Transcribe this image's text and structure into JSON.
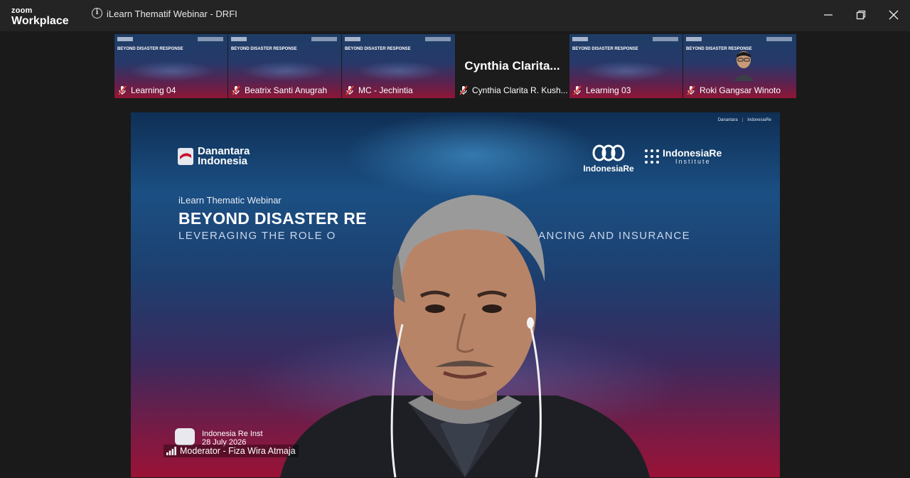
{
  "app": {
    "brand_small": "zoom",
    "brand_big": "Workplace",
    "window_title": "iLearn Thematif Webinar - DRFI"
  },
  "gallery": [
    {
      "name": "Learning 04",
      "muted": true,
      "has_video": true
    },
    {
      "name": "Beatrix Santi Anugrah",
      "muted": true,
      "has_video": true
    },
    {
      "name": "MC - Jechintia",
      "muted": true,
      "has_video": true
    },
    {
      "name": "Cynthia Clarita R. Kush...",
      "display_name": "Cynthia  Clarita...",
      "muted": true,
      "has_video": false
    },
    {
      "name": "Learning 03",
      "muted": true,
      "has_video": true
    },
    {
      "name": "Roki Gangsar Winoto",
      "muted": true,
      "has_video": true
    }
  ],
  "slide": {
    "mini_title": "BEYOND DISASTER RESPONSE",
    "org_left_line1": "Danantara",
    "org_left_line2": "Indonesia",
    "org_right_1": "IndonesiaRe",
    "org_right_2": "IndonesiaRe",
    "org_right_2_sub": "Institute",
    "webinar_label": "iLearn Thematic Webinar",
    "headline": "BEYOND DISASTER RE",
    "subhead_left": "LEVERAGING THE ROLE O",
    "subhead_right": "NANCING AND INSURANCE",
    "footer_line1": "Indonesia Re Inst",
    "footer_line2": "28 July 2026"
  },
  "active_speaker": {
    "label": "Moderator - Fiza Wira Atmaja"
  },
  "colors": {
    "titlebar": "#242424",
    "background": "#1a1a1a",
    "muted_icon": "#e0443a"
  }
}
